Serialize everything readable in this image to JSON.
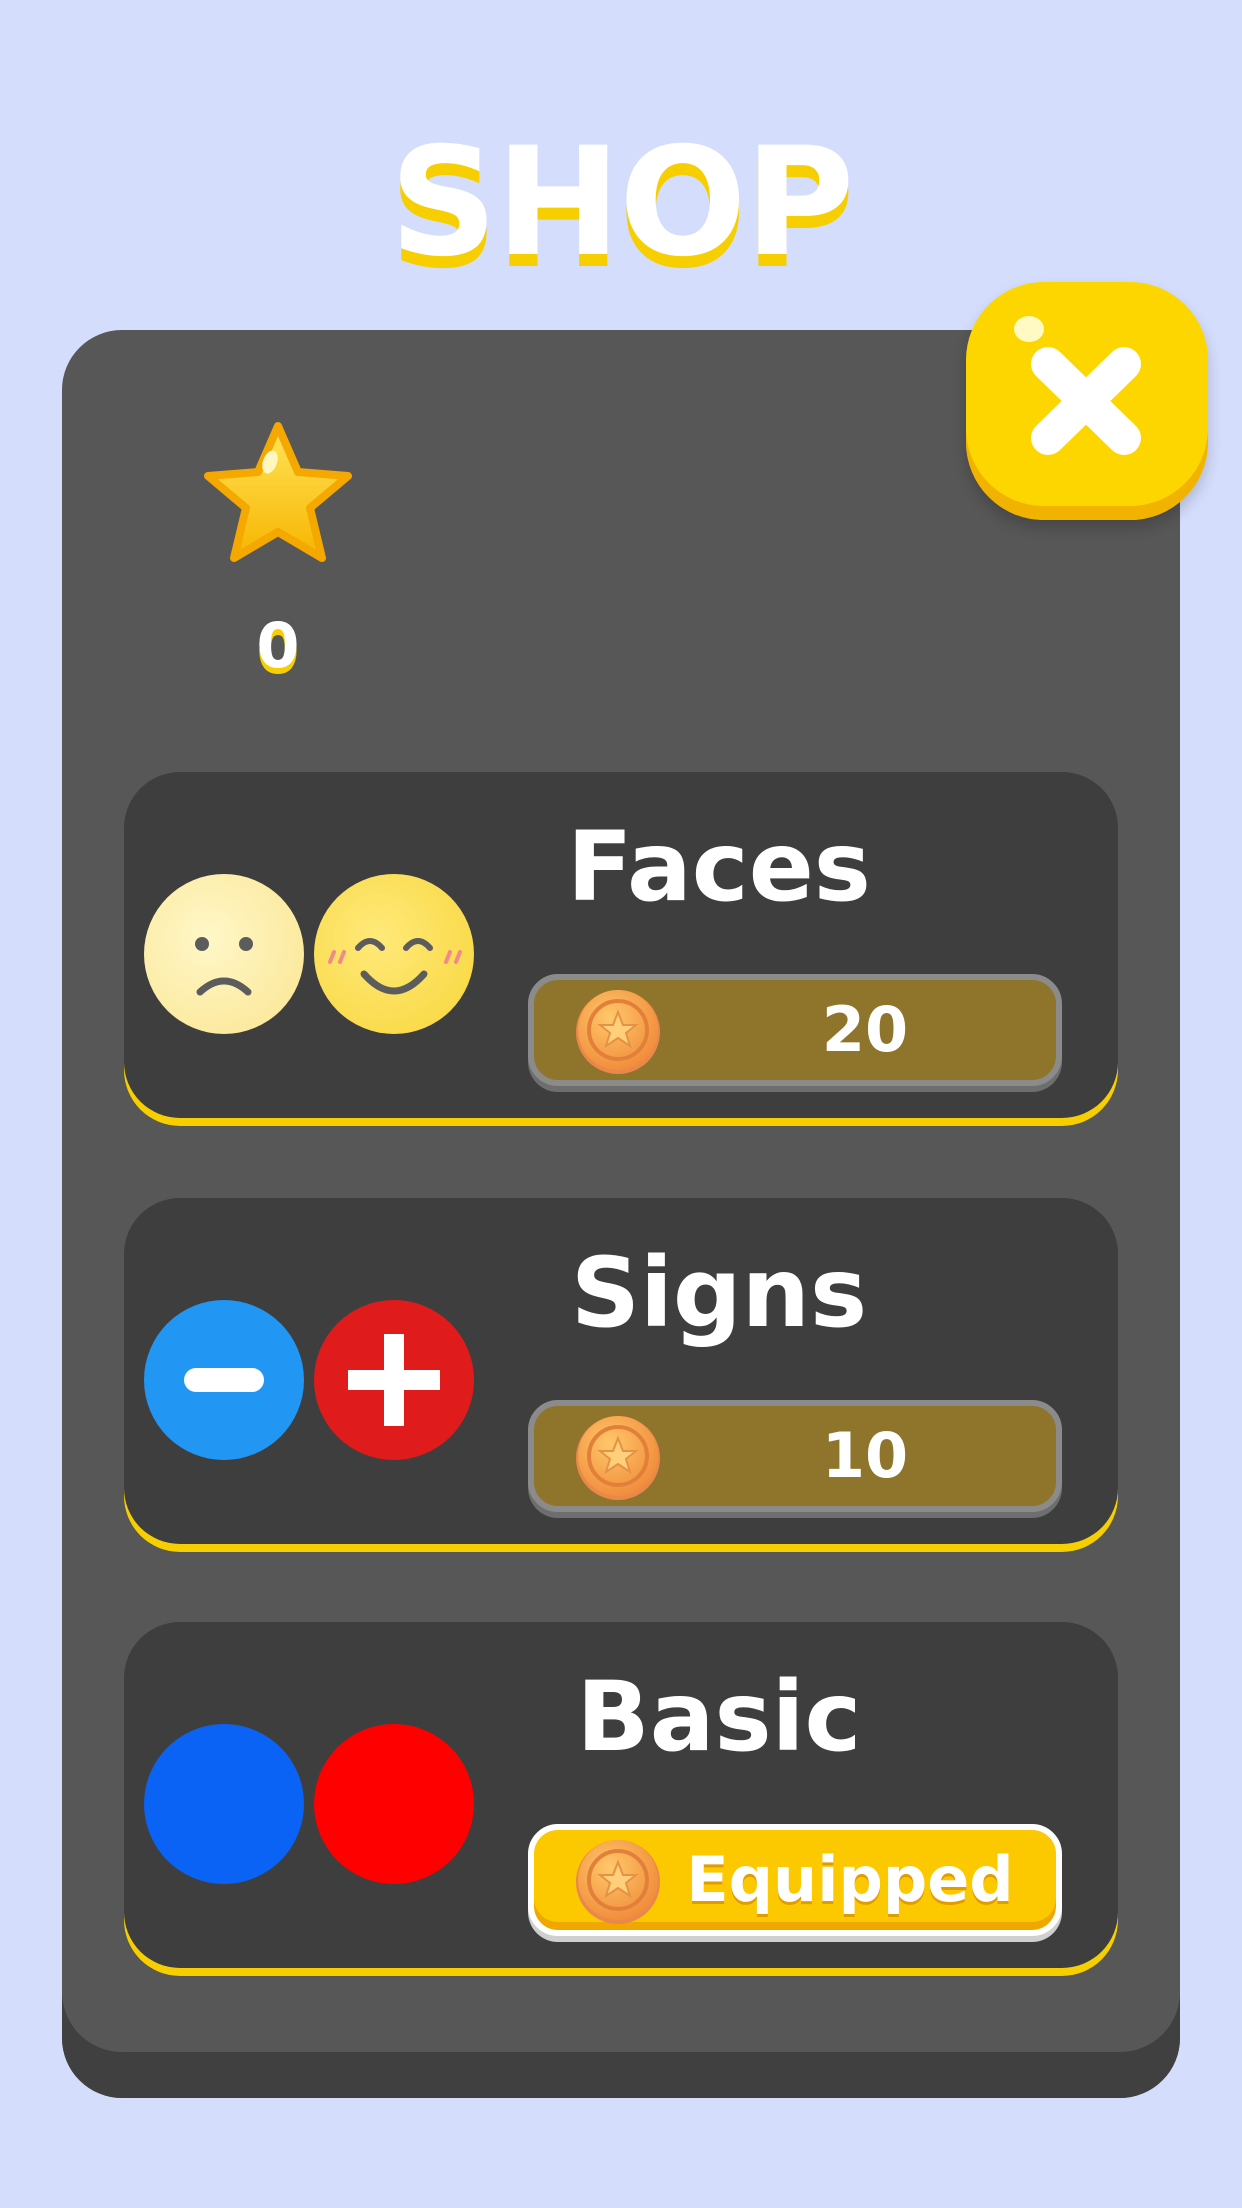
{
  "title": "SHOP",
  "close_icon": "close-x-icon",
  "currency": {
    "icon": "star-icon",
    "count": "0"
  },
  "colors": {
    "background": "#d4ddfc",
    "panel": "#575757",
    "card": "#3e3e3e",
    "accent_yellow": "#fdd600",
    "locked_button": "#8f742b"
  },
  "items": [
    {
      "name": "Faces",
      "tokens": [
        "sad-face-icon",
        "happy-face-icon"
      ],
      "price_icon": "coin-icon",
      "price": "20",
      "state": "locked"
    },
    {
      "name": "Signs",
      "tokens": [
        "minus-sign-icon",
        "plus-sign-icon"
      ],
      "price_icon": "coin-icon",
      "price": "10",
      "state": "locked"
    },
    {
      "name": "Basic",
      "tokens": [
        "blue-circle",
        "red-circle"
      ],
      "price_icon": "coin-icon",
      "price": "Equipped",
      "state": "equipped"
    }
  ]
}
